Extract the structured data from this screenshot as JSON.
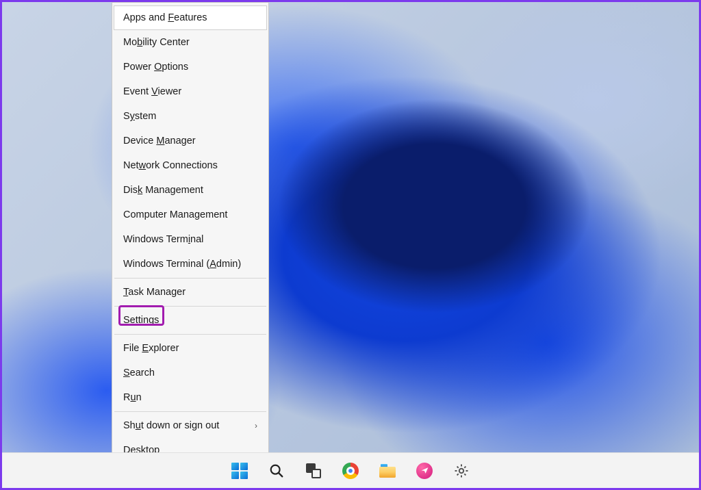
{
  "wallpaper": "windows-11-bloom-blue",
  "winx_menu": {
    "hovered_index": 0,
    "items": [
      {
        "prefix": "Apps and ",
        "mnemonic": "F",
        "suffix": "eatures"
      },
      {
        "prefix": "Mo",
        "mnemonic": "b",
        "suffix": "ility Center"
      },
      {
        "prefix": "Power ",
        "mnemonic": "O",
        "suffix": "ptions"
      },
      {
        "prefix": "Event ",
        "mnemonic": "V",
        "suffix": "iewer"
      },
      {
        "prefix": "S",
        "mnemonic": "y",
        "suffix": "stem"
      },
      {
        "prefix": "Device ",
        "mnemonic": "M",
        "suffix": "anager"
      },
      {
        "prefix": "Net",
        "mnemonic": "w",
        "suffix": "ork Connections"
      },
      {
        "prefix": "Dis",
        "mnemonic": "k",
        "suffix": " Management"
      },
      {
        "prefix": "Computer Mana",
        "mnemonic": "g",
        "suffix": "ement"
      },
      {
        "prefix": "Windows Term",
        "mnemonic": "i",
        "suffix": "nal"
      },
      {
        "prefix": "Windows Terminal (",
        "mnemonic": "A",
        "suffix": "dmin)",
        "separator_after": true
      },
      {
        "prefix": "",
        "mnemonic": "T",
        "suffix": "ask Manager",
        "separator_after": true
      },
      {
        "prefix": "Setti",
        "mnemonic": "n",
        "suffix": "gs",
        "highlighted": true,
        "separator_after": true
      },
      {
        "prefix": "File ",
        "mnemonic": "E",
        "suffix": "xplorer"
      },
      {
        "prefix": "",
        "mnemonic": "S",
        "suffix": "earch"
      },
      {
        "prefix": "R",
        "mnemonic": "u",
        "suffix": "n",
        "separator_after": true
      },
      {
        "prefix": "Sh",
        "mnemonic": "u",
        "suffix": "t down or sign out",
        "submenu": true
      },
      {
        "prefix": "",
        "mnemonic": "D",
        "suffix": "esktop"
      }
    ]
  },
  "taskbar": {
    "buttons": [
      {
        "name": "start",
        "icon": "windows-start-icon"
      },
      {
        "name": "search",
        "icon": "search-icon"
      },
      {
        "name": "task-view",
        "icon": "task-view-icon"
      },
      {
        "name": "chrome",
        "icon": "chrome-icon"
      },
      {
        "name": "file-explorer",
        "icon": "file-explorer-icon"
      },
      {
        "name": "media-app",
        "icon": "paper-plane-icon"
      },
      {
        "name": "settings",
        "icon": "gear-icon"
      }
    ]
  },
  "highlight_color": "#a21caf"
}
